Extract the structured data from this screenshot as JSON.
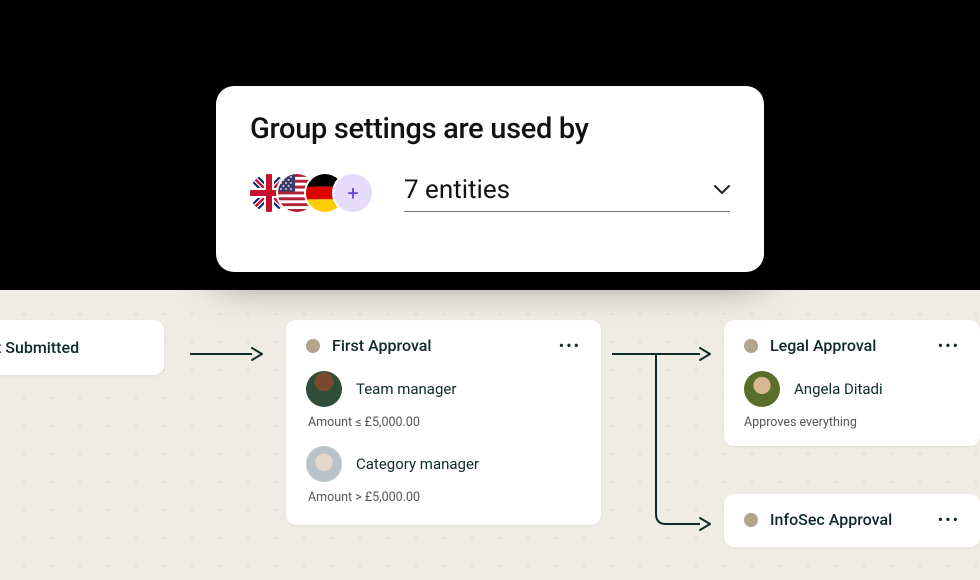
{
  "settings_card": {
    "title": "Group settings are used by",
    "entities_label": "7 entities",
    "plus_label": "+",
    "flags": [
      "uk",
      "us",
      "de"
    ]
  },
  "workflow": {
    "start": {
      "label": "e Request Submitted"
    },
    "first_approval": {
      "title": "First Approval",
      "approver1": {
        "label": "Team manager",
        "rule": "Amount ≤ £5,000.00"
      },
      "approver2": {
        "label": "Category manager",
        "rule": "Amount > £5,000.00"
      }
    },
    "legal_approval": {
      "title": "Legal Approval",
      "approver": {
        "label": "Angela Ditadi"
      },
      "rule": "Approves everything"
    },
    "infosec_approval": {
      "title": "InfoSec Approval"
    },
    "more_glyph": "•••"
  }
}
